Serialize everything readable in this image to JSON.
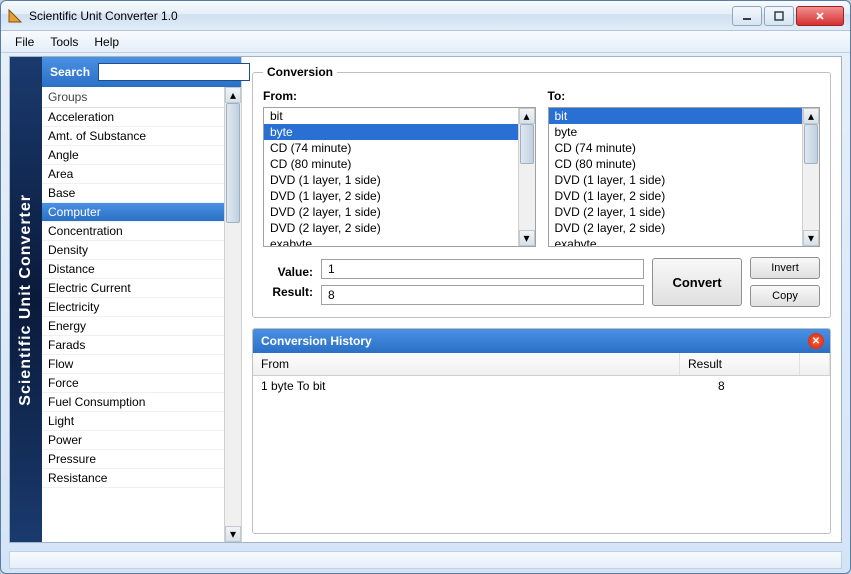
{
  "window": {
    "title": "Scientific Unit Converter 1.0"
  },
  "menu": {
    "file": "File",
    "tools": "Tools",
    "help": "Help"
  },
  "side_label": "Scientific Unit Converter",
  "search": {
    "label": "Search",
    "value": ""
  },
  "groups": {
    "header": "Groups",
    "items": [
      "Acceleration",
      "Amt. of Substance",
      "Angle",
      "Area",
      "Base",
      "Computer",
      "Concentration",
      "Density",
      "Distance",
      "Electric Current",
      "Electricity",
      "Energy",
      "Farads",
      "Flow",
      "Force",
      "Fuel Consumption",
      "Light",
      "Power",
      "Pressure",
      "Resistance"
    ],
    "selected_index": 5
  },
  "conversion": {
    "title": "Conversion",
    "from_label": "From:",
    "to_label": "To:",
    "units": [
      "bit",
      "byte",
      "CD (74 minute)",
      "CD (80 minute)",
      "DVD (1 layer, 1 side)",
      "DVD (1 layer, 2 side)",
      "DVD (2 layer, 1 side)",
      "DVD (2 layer, 2 side)",
      "exabyte"
    ],
    "from_selected_index": 1,
    "to_selected_index": 0,
    "value_label": "Value:",
    "result_label": "Result:",
    "value": "1",
    "result": "8",
    "convert_btn": "Convert",
    "invert_btn": "Invert",
    "copy_btn": "Copy"
  },
  "history": {
    "title": "Conversion History",
    "col_from": "From",
    "col_result": "Result",
    "rows": [
      {
        "from": "1 byte To bit",
        "result": "8"
      }
    ]
  }
}
